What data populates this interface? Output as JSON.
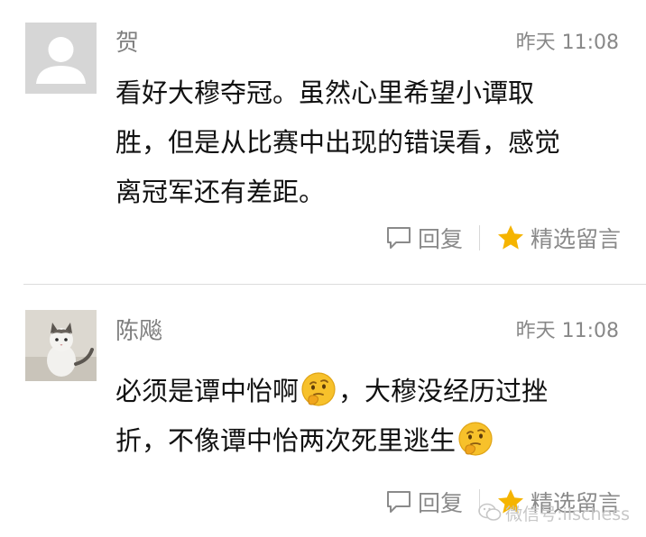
{
  "comments": [
    {
      "nickname": "贺",
      "time": "昨天 11:08",
      "lines": [
        "看好大穆夺冠。虽然心里希望小谭取",
        "胜，但是从比赛中出现的错误看，感觉",
        "离冠军还有差距。"
      ],
      "reply_label": "回复",
      "featured_label": "精选留言"
    },
    {
      "nickname": "陈飚",
      "time": "昨天 11:08",
      "line1_a": "必须是谭中怡啊",
      "line1_b": "，大穆没经历过挫",
      "line2": "折，不像谭中怡两次死里逃生",
      "reply_label": "回复",
      "featured_label": "精选留言"
    }
  ],
  "watermark": {
    "text": "微信号:ilschess"
  },
  "colors": {
    "star": "#f5b400",
    "emoji_face": "#f7c12b",
    "muted_text": "#888888",
    "divider": "#dcdcdc"
  },
  "icons": {
    "avatar_default": "default-user-icon",
    "avatar_cat": "cat-photo",
    "reply": "speech-bubble-icon",
    "featured": "star-icon",
    "emoji": "thinking-face-emoji"
  }
}
